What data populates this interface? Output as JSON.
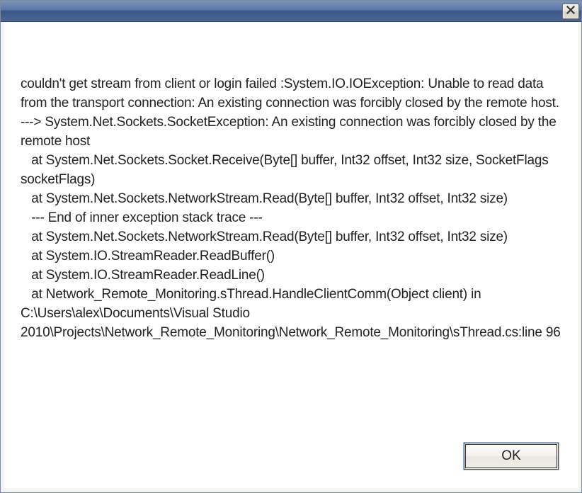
{
  "dialog": {
    "message": "couldn't get stream from client or login failed :System.IO.IOException: Unable to read data from the transport connection: An existing connection was forcibly closed by the remote host. ---> System.Net.Sockets.SocketException: An existing connection was forcibly closed by the remote host\n   at System.Net.Sockets.Socket.Receive(Byte[] buffer, Int32 offset, Int32 size, SocketFlags socketFlags)\n   at System.Net.Sockets.NetworkStream.Read(Byte[] buffer, Int32 offset, Int32 size)\n   --- End of inner exception stack trace ---\n   at System.Net.Sockets.NetworkStream.Read(Byte[] buffer, Int32 offset, Int32 size)\n   at System.IO.StreamReader.ReadBuffer()\n   at System.IO.StreamReader.ReadLine()\n   at Network_Remote_Monitoring.sThread.HandleClientComm(Object client) in C:\\Users\\alex\\Documents\\Visual Studio 2010\\Projects\\Network_Remote_Monitoring\\Network_Remote_Monitoring\\sThread.cs:line 96",
    "ok_label": "OK"
  }
}
